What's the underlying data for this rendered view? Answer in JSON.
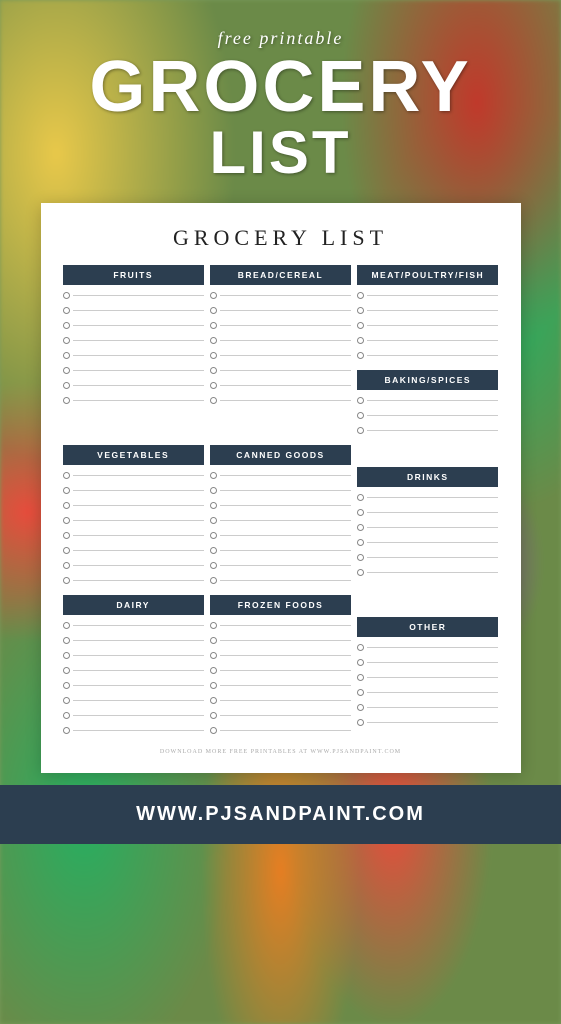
{
  "header": {
    "free_printable": "free printable",
    "grocery": "GROCERY",
    "list_word": "LIST"
  },
  "card": {
    "title": "GROCERY LIST",
    "categories": {
      "fruits": "FRUITS",
      "bread_cereal": "BREAD/CEREAL",
      "meat": "MEAT/POULTRY/FISH",
      "vegetables": "VEGETABLES",
      "canned_goods": "CANNED GOODS",
      "baking_spices": "BAKING/SPICES",
      "dairy": "DAIRY",
      "frozen_foods": "FROZEN FOODS",
      "drinks": "DRINKS",
      "other": "OTHER"
    },
    "footer": "DOWNLOAD MORE FREE PRINTABLES AT WWW.PJSANDPAINT.COM"
  },
  "bottom_banner": {
    "url": "WWW.PJSANDPAINT.COM"
  }
}
